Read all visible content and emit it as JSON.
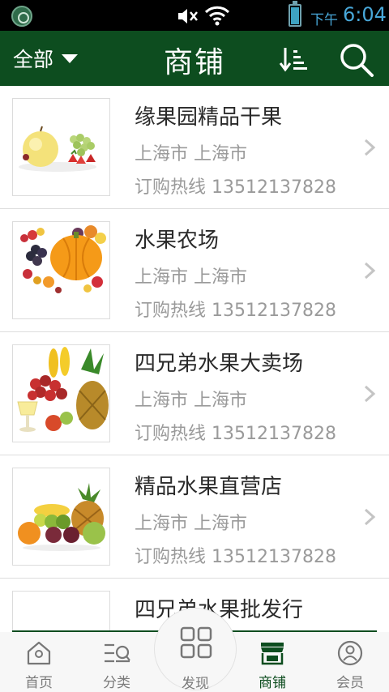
{
  "status_bar": {
    "time_label": "下午",
    "time": "6:04"
  },
  "header": {
    "filter_label": "全部",
    "title": "商铺",
    "sort_icon": "sort-icon",
    "search_icon": "search-icon"
  },
  "stores": [
    {
      "name": "缘果园精品干果",
      "location": "上海市 上海市",
      "hotline": "订购热线 13512137828"
    },
    {
      "name": "水果农场",
      "location": "上海市 上海市",
      "hotline": "订购热线 13512137828"
    },
    {
      "name": "四兄弟水果大卖场",
      "location": "上海市 上海市",
      "hotline": "订购热线 13512137828"
    },
    {
      "name": "精品水果直营店",
      "location": "上海市 上海市",
      "hotline": "订购热线 13512137828"
    },
    {
      "name": "四兄弟水果批发行",
      "location": "",
      "hotline": ""
    }
  ],
  "bottom_nav": {
    "items": [
      {
        "label": "首页",
        "icon": "home-icon"
      },
      {
        "label": "分类",
        "icon": "category-icon"
      },
      {
        "label": "发现",
        "icon": "grid-icon"
      },
      {
        "label": "商铺",
        "icon": "store-icon",
        "active": true
      },
      {
        "label": "会员",
        "icon": "user-icon"
      }
    ]
  },
  "colors": {
    "primary": "#0d4d1f",
    "status_time": "#48a7d8",
    "secondary_text": "#9a9a9a"
  }
}
